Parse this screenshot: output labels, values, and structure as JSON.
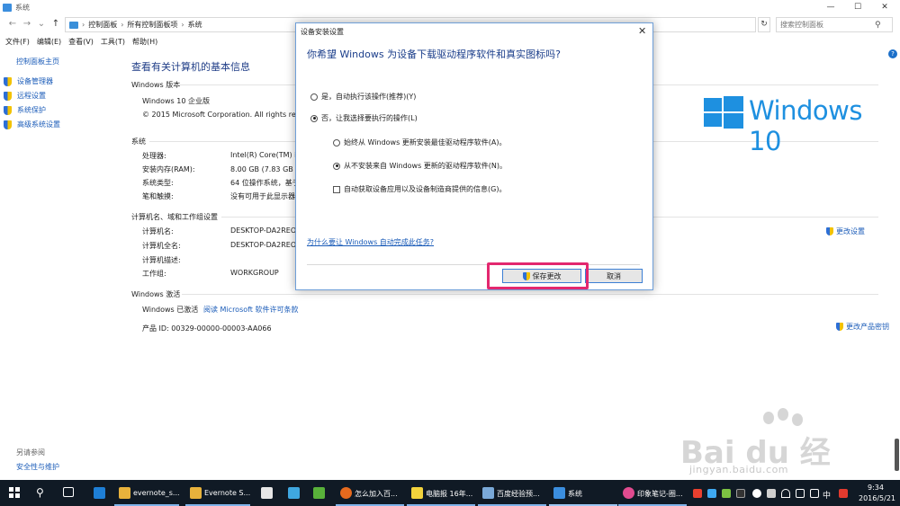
{
  "window": {
    "title": "系统",
    "minimize": "—",
    "maximize": "☐",
    "close": "✕"
  },
  "nav": {
    "back": "←",
    "forward": "→",
    "dropdown": "⌄",
    "up": "↑",
    "breadcrumb": [
      "控制面板",
      "所有控制面板项",
      "系统"
    ],
    "breadcrumb_sep": "›",
    "refresh": "↻",
    "search_placeholder": "搜索控制面板"
  },
  "menu": [
    "文件(F)",
    "编辑(E)",
    "查看(V)",
    "工具(T)",
    "帮助(H)"
  ],
  "help": "?",
  "sidebar": {
    "home": "控制面板主页",
    "items": [
      "设备管理器",
      "远程设置",
      "系统保护",
      "高级系统设置"
    ],
    "see_also": "另请参阅",
    "security": "安全性与维护"
  },
  "main": {
    "title": "查看有关计算机的基本信息",
    "edition_head": "Windows 版本",
    "edition": "Windows 10 企业版",
    "copyright": "© 2015 Microsoft Corporation. All rights rese",
    "logo_text": "Windows 10",
    "system_head": "系统",
    "system_rows": [
      {
        "label": "处理器:",
        "value": "Intel(R) Core(TM) i7"
      },
      {
        "label": "安装内存(RAM):",
        "value": "8.00 GB (7.83 GB 可"
      },
      {
        "label": "系统类型:",
        "value": "64 位操作系统，基于"
      },
      {
        "label": "笔和触摸:",
        "value": "没有可用于此显示器"
      }
    ],
    "name_head": "计算机名、域和工作组设置",
    "name_rows": [
      {
        "label": "计算机名:",
        "value": "DESKTOP-DA2REO"
      },
      {
        "label": "计算机全名:",
        "value": "DESKTOP-DA2REO"
      },
      {
        "label": "计算机描述:",
        "value": ""
      },
      {
        "label": "工作组:",
        "value": "WORKGROUP"
      }
    ],
    "change_settings": "更改设置",
    "activation_head": "Windows 激活",
    "activated": "Windows 已激活",
    "license_link": "阅读 Microsoft 软件许可条款",
    "product_id": "产品 ID: 00329-00000-00003-AA066",
    "change_key": "更改产品密钥"
  },
  "dialog": {
    "title": "设备安装设置",
    "close": "✕",
    "question": "你希望 Windows 为设备下载驱动程序软件和真实图标吗?",
    "opt_yes": "是，自动执行该操作(推荐)(Y)",
    "opt_no": "否，让我选择要执行的操作(L)",
    "sub_always": "始终从 Windows 更新安装最佳驱动程序软件(A)。",
    "sub_never": "从不安装来自 Windows 更新的驱动程序软件(N)。",
    "check_info": "自动获取设备应用以及设备制造商提供的信息(G)。",
    "why_link": "为什么要让 Windows 自动完成此任务?",
    "save": "保存更改",
    "cancel": "取消"
  },
  "watermark": {
    "brand": "Bai du 经验",
    "url": "jingyan.baidu.com"
  },
  "taskbar": {
    "search": "⚲",
    "apps": [
      {
        "label": "evernote_s..."
      },
      {
        "label": "Evernote S..."
      },
      {
        "label": "怎么加入百..."
      },
      {
        "label": "电脑报 16年..."
      },
      {
        "label": "百度经验预..."
      },
      {
        "label": "系统"
      },
      {
        "label": "印象笔记-圈..."
      }
    ],
    "ime": "中",
    "time": "9:34",
    "date": "2016/5/21"
  },
  "colors": {
    "accent": "#1e90e0",
    "link": "#1a5bb8",
    "highlight": "#e3286f",
    "taskbar": "#101a25"
  }
}
